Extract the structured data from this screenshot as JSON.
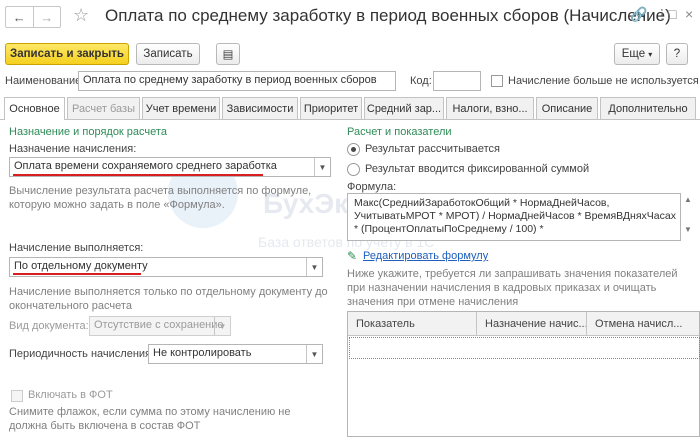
{
  "window": {
    "title": "Оплата по среднему заработку в период военных сборов (Начисление)"
  },
  "toolbar": {
    "save_close": "Записать и закрыть",
    "save": "Записать",
    "more": "Еще",
    "help": "?"
  },
  "header": {
    "name_label": "Наименование:",
    "name_value": "Оплата по среднему заработку в период военных сборов",
    "code_label": "Код:",
    "code_value": "",
    "unused_label": "Начисление больше не используется"
  },
  "tabs": [
    {
      "label": "Основное",
      "active": true
    },
    {
      "label": "Расчет базы",
      "disabled": true
    },
    {
      "label": "Учет времени"
    },
    {
      "label": "Зависимости"
    },
    {
      "label": "Приоритет"
    },
    {
      "label": "Средний зар..."
    },
    {
      "label": "Налоги, взно..."
    },
    {
      "label": "Описание"
    },
    {
      "label": "Дополнительно"
    }
  ],
  "left": {
    "section_title": "Назначение и порядок расчета",
    "purpose_label": "Назначение начисления:",
    "purpose_value": "Оплата времени сохраняемого среднего заработка",
    "purpose_hint_1": "Вычисление результата расчета выполняется по формуле,",
    "purpose_hint_2": "которую можно задать в поле «Формула».",
    "performed_label": "Начисление выполняется:",
    "performed_value": "По отдельному документу",
    "performed_hint_1": "Начисление выполняется только по отдельному документу до",
    "performed_hint_2": "окончательного расчета",
    "doc_type_label": "Вид документа:",
    "doc_type_value": "Отсутствие с сохранение",
    "periodicity_label": "Периодичность начисления:",
    "periodicity_value": "Не контролировать",
    "fot_label": "Включать в ФОТ",
    "fot_hint_1": "Снимите флажок, если сумма по этому начислению не",
    "fot_hint_2": "должна быть включена в состав ФОТ"
  },
  "right": {
    "section_title": "Расчет и показатели",
    "radio_calculated": "Результат рассчитывается",
    "radio_fixed": "Результат вводится фиксированной суммой",
    "formula_label": "Формула:",
    "formula_line_1": "Макс(СреднийЗаработокОбщий * НормаДнейЧасов,",
    "formula_line_2": "УчитыватьМРОТ * МРОТ) / НормаДнейЧасов * ВремяВДняхЧасах",
    "formula_line_3": "* (ПроцентОплатыПоСреднему / 100) *",
    "edit_formula_link": "Редактировать формулу",
    "indicators_hint_1": "Ниже укажите, требуется ли запрашивать значения показателей",
    "indicators_hint_2": "при назначении начисления в кадровых приказах и очищать",
    "indicators_hint_3": "значения при отмене начисления",
    "table_columns": [
      "Показатель",
      "Назначение начис...",
      "Отмена начисл..."
    ]
  },
  "watermark": {
    "brand": "БухЭксперт",
    "tagline": "База ответов по учету в 1С"
  },
  "colors": {
    "primary_button": "#f5d01f",
    "section_title": "#2e8b57",
    "link": "#1f5fbd",
    "underline_mark": "#d81e1e"
  }
}
